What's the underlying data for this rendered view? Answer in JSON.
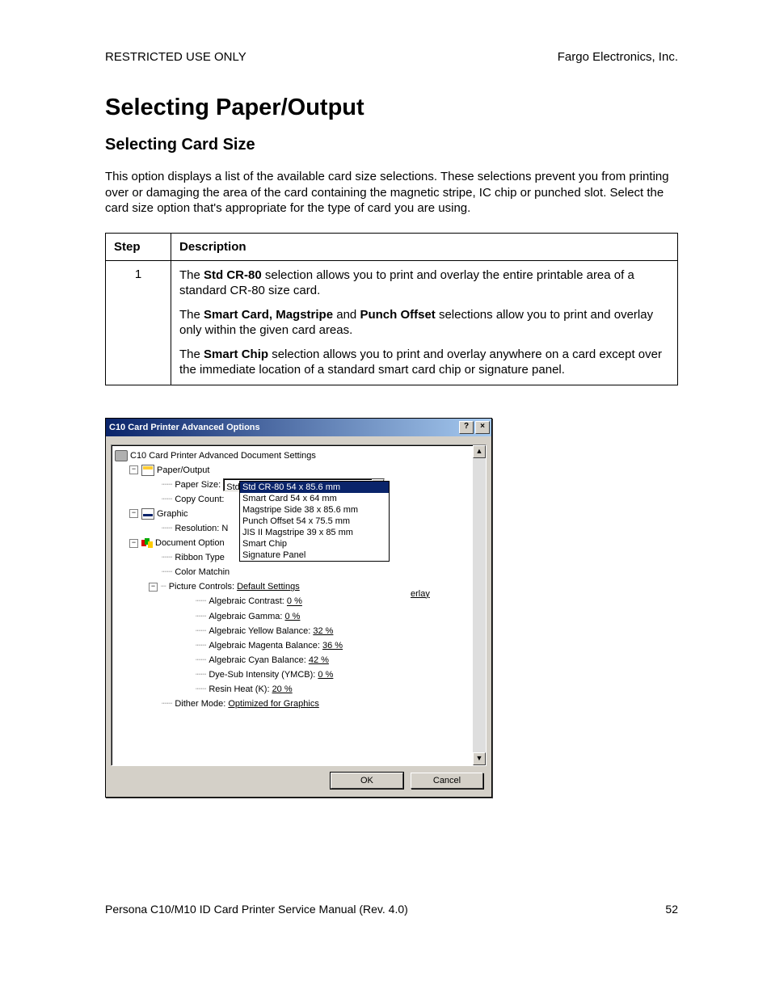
{
  "header": {
    "left": "RESTRICTED USE ONLY",
    "right": "Fargo Electronics, Inc."
  },
  "title": "Selecting Paper/Output",
  "subtitle": "Selecting Card Size",
  "intro": "This option displays a list of the available card size selections. These selections prevent you from printing over or damaging the area of the card containing the magnetic stripe, IC chip or punched slot. Select the card size option that's appropriate for the type of card you are using.",
  "table": {
    "headers": {
      "step": "Step",
      "desc": "Description"
    },
    "rows": [
      {
        "step": "1",
        "p1_a": "The ",
        "p1_b": "Std CR-80",
        "p1_c": " selection allows you to print and overlay the entire printable area of a standard CR-80 size card.",
        "p2_a": "The ",
        "p2_b": "Smart Card, Magstripe",
        "p2_c": " and ",
        "p2_d": "Punch Offset",
        "p2_e": " selections allow you to print and overlay only within the given card areas.",
        "p3_a": "The ",
        "p3_b": "Smart Chip",
        "p3_c": " selection allows you to print and overlay anywhere on a card except over the immediate location of a standard smart card chip or signature panel."
      }
    ]
  },
  "dialog": {
    "title": "C10 Card Printer Advanced Options",
    "help": "?",
    "close": "×",
    "root": "C10 Card Printer Advanced Document Settings",
    "paper_output": "Paper/Output",
    "paper_size_label": "Paper Size:",
    "paper_size_value": "Std CR-80  54 x 85.6 mm",
    "copy_count_label": "Copy Count:",
    "dropdown_options": [
      "Std CR-80  54 x 85.6 mm",
      "Smart Card  54 x 64 mm",
      "Magstripe Side  38 x 85.6 mm",
      "Punch Offset  54 x 75.5 mm",
      "JIS II Magstripe  39 x 85 mm",
      "Smart Chip",
      "Signature Panel"
    ],
    "graphic": "Graphic",
    "resolution_label": "Resolution: ",
    "resolution_cut": "N",
    "doc_options": "Document Option",
    "ribbon_type_label": "Ribbon Type",
    "color_matching_label": "Color Matchin",
    "cut_text": "erlay",
    "picture_controls_label": "Picture Controls: ",
    "picture_controls_value": "Default Settings",
    "items": {
      "contrast": {
        "l": "Algebraic Contrast: ",
        "v": "0 %"
      },
      "gamma": {
        "l": "Algebraic Gamma: ",
        "v": "0 %"
      },
      "yellow": {
        "l": "Algebraic Yellow Balance: ",
        "v": "32 %"
      },
      "magenta": {
        "l": "Algebraic Magenta Balance: ",
        "v": "36 %"
      },
      "cyan": {
        "l": "Algebraic Cyan Balance: ",
        "v": "42 %"
      },
      "dyesub": {
        "l": "Dye-Sub Intensity (YMCB): ",
        "v": "0 %"
      },
      "resin": {
        "l": "Resin Heat (K): ",
        "v": "20 %"
      }
    },
    "dither_label": "Dither Mode: ",
    "dither_value": "Optimized for Graphics",
    "ok": "OK",
    "cancel": "Cancel"
  },
  "footer": {
    "left": "Persona C10/M10 ID Card Printer Service Manual (Rev. 4.0)",
    "right": "52"
  }
}
